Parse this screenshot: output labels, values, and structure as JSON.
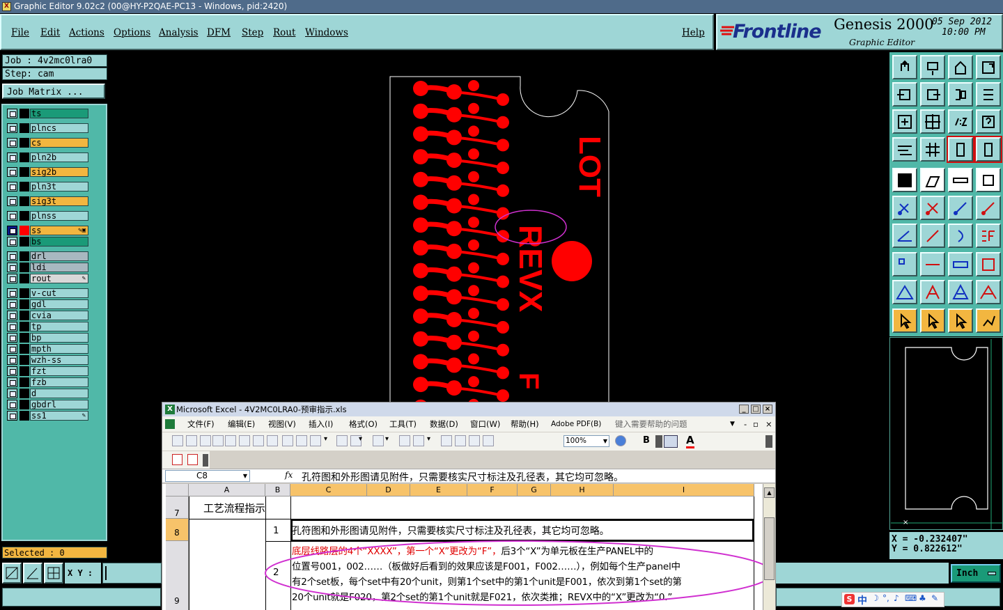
{
  "window": {
    "title": "Graphic Editor 9.02c2 (00@HY-P2QAE-PC13 - Windows, pid:2420)",
    "app_icon": "x-logo-icon"
  },
  "menu": [
    "File",
    "Edit",
    "Actions",
    "Options",
    "Analysis",
    "DFM",
    "Step",
    "Rout",
    "Windows"
  ],
  "help_label": "Help",
  "brand": {
    "logo": "Frontline",
    "product": "Genesis 2000",
    "subtitle": "Graphic Editor",
    "date": "05 Sep 2012",
    "time": "10:00 PM"
  },
  "job": {
    "job_line": "Job : 4v2mc0lra0",
    "step_line": "Step: cam",
    "matrix_button": "Job Matrix ..."
  },
  "layers": [
    {
      "name": "ts",
      "color": "#1a9a78"
    },
    {
      "name": "plncs",
      "color": "#9ed6d6"
    },
    {
      "name": "cs",
      "color": "#f2b640"
    },
    {
      "name": "pln2b",
      "color": "#9ed6d6"
    },
    {
      "name": "sig2b",
      "color": "#f2b640"
    },
    {
      "name": "pln3t",
      "color": "#9ed6d6"
    },
    {
      "name": "sig3t",
      "color": "#f2b640"
    },
    {
      "name": "plnss",
      "color": "#9ed6d6"
    },
    {
      "name": "ss",
      "color": "#f2b640",
      "active": true
    },
    {
      "name": "bs",
      "color": "#1a9a78"
    },
    {
      "name": "drl",
      "color": "#a8b8c0"
    },
    {
      "name": "ldi",
      "color": "#a8b8c0"
    },
    {
      "name": "rout",
      "color": "#d8d8d8"
    },
    {
      "name": "v-cut",
      "color": "#9ed6d6"
    },
    {
      "name": "gdl",
      "color": "#9ed6d6"
    },
    {
      "name": "cvia",
      "color": "#9ed6d6"
    },
    {
      "name": "tp",
      "color": "#9ed6d6"
    },
    {
      "name": "bp",
      "color": "#9ed6d6"
    },
    {
      "name": "mpth",
      "color": "#9ed6d6"
    },
    {
      "name": "wzh-ss",
      "color": "#9ed6d6"
    },
    {
      "name": "fzt",
      "color": "#9ed6d6"
    },
    {
      "name": "fzb",
      "color": "#9ed6d6"
    },
    {
      "name": "d",
      "color": "#9ed6d6"
    },
    {
      "name": "gbdrl",
      "color": "#9ed6d6"
    },
    {
      "name": "ss1",
      "color": "#9ed6d6"
    }
  ],
  "selected_label": "Selected : 0",
  "xy_label": "X Y :",
  "units_button": "Inch",
  "coords": {
    "x": "X = -0.232407\"",
    "y": "Y =  0.822612\""
  },
  "board_text": {
    "lot": "LOT",
    "revx": "REVX",
    "f": "F"
  },
  "colors": {
    "pcb_red": "#ff0000",
    "panel_teal": "#9ed6d6",
    "layer_bg": "#50b8a8",
    "highlight_ellipse": "#d030d0"
  },
  "excel": {
    "title": "Microsoft Excel - 4V2MC0LRA0-预审指示.xls",
    "menu": [
      "文件(F)",
      "编辑(E)",
      "视图(V)",
      "插入(I)",
      "格式(O)",
      "工具(T)",
      "数据(D)",
      "窗口(W)",
      "帮助(H)",
      "Adobe PDF(B)"
    ],
    "help_placeholder": "键入需要帮助的问题",
    "zoom": "100%",
    "name_box": "C8",
    "formula": "孔符图和外形图请见附件，只需要核实尺寸标注及孔径表，其它均可忽略。",
    "columns": [
      "A",
      "B",
      "C",
      "D",
      "E",
      "F",
      "G",
      "H",
      "I"
    ],
    "rows": [
      "7",
      "8",
      "9"
    ],
    "a7": "工艺流程指示",
    "b8": "1",
    "c8": "孔符图和外形图请见附件，只需要核实尺寸标注及孔径表，其它均可忽略。",
    "b9": "2",
    "c9_red": "底层线路层的4个“XXXX”，第一个“X”更改为“F”，",
    "c9_line1": "后3个“X”为单元板在生产PANEL中的",
    "c9_line2": "位置号001，002……（板做好后看到的效果应该是F001，F002……），例如每个生产panel中",
    "c9_line3": "有2个set板，每个set中有20个unit，则第1个set中的第1个unit是F001，依次到第1个set的第",
    "c9_line4": "20个unit就是F020，第2个set的第1个unit就是F021，依次类推；REVX中的“X”更改为“0.”"
  },
  "tray": [
    "中"
  ]
}
